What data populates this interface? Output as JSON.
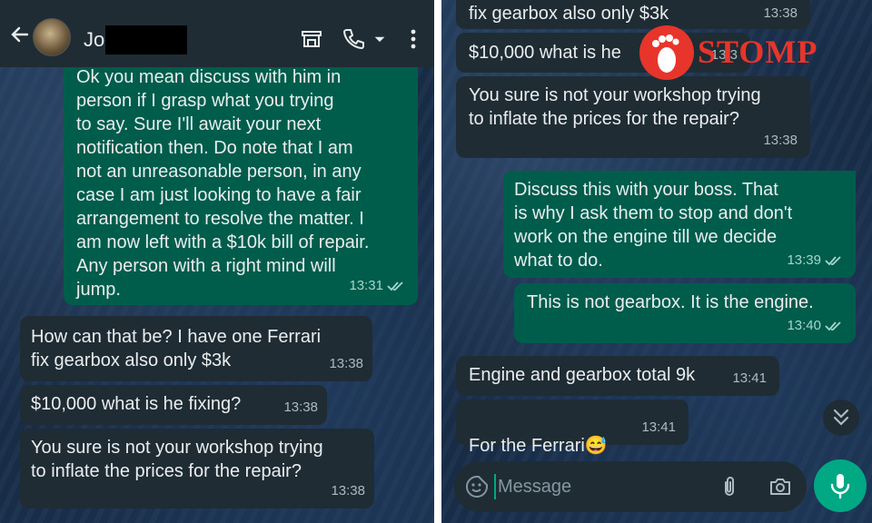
{
  "left": {
    "header": {
      "contact_name": "Jo",
      "icons": [
        "back-arrow-icon",
        "avatar",
        "shop-icon",
        "phone-icon",
        "dropdown-icon",
        "more-vertical-icon"
      ]
    },
    "messages": [
      {
        "direction": "out",
        "text": "Ok you mean discuss with him in\nperson if I grasp what you trying\nto say. Sure I'll await your next\nnotification then. Do note that I am\nnot an unreasonable person, in any\ncase I am just looking to have a fair\narrangement to resolve the matter. I\nam now left with a $10k bill of repair.\nAny person with a right mind will\njump.",
        "time": "13:31"
      },
      {
        "direction": "in",
        "text": "How can that be? I have one Ferrari\nfix gearbox also only $3k",
        "time": "13:38"
      },
      {
        "direction": "in",
        "text": "$10,000 what is he fixing?",
        "time": "13:38"
      },
      {
        "direction": "in",
        "text": "You sure is not your workshop trying\nto inflate the prices for the repair?",
        "time": "13:38"
      }
    ]
  },
  "right": {
    "messages": [
      {
        "direction": "in",
        "text": "fix gearbox also only $3k",
        "time": "13:38"
      },
      {
        "direction": "in",
        "text": "$10,000 what is he",
        "time": "13:3"
      },
      {
        "direction": "in",
        "text": "You sure is not your workshop trying\nto inflate the prices for the repair?",
        "time": "13:38"
      },
      {
        "direction": "out",
        "text": "Discuss this with your boss. That\nis why I ask them to stop and don't\nwork on the engine till we decide\nwhat to do.",
        "time": "13:39"
      },
      {
        "direction": "out",
        "text": "This is not gearbox. It is the engine.",
        "time": "13:40"
      },
      {
        "direction": "in",
        "text": "Engine and gearbox total 9k",
        "time": "13:41"
      },
      {
        "direction": "in",
        "text": "For the Ferrari",
        "emoji": "😅",
        "time": "13:41"
      }
    ],
    "watermark": {
      "text": "STOMP",
      "color": "#e8352b"
    },
    "composer": {
      "placeholder": "Message",
      "icons": [
        "emoji-sticker-icon",
        "attach-icon",
        "camera-icon",
        "mic-icon",
        "scroll-down-icon"
      ]
    }
  },
  "colors": {
    "incoming_bubble": "#202c33",
    "outgoing_bubble": "#005c4b",
    "accent": "#00a884",
    "text": "#e9edef",
    "meta": "#aebac1"
  }
}
